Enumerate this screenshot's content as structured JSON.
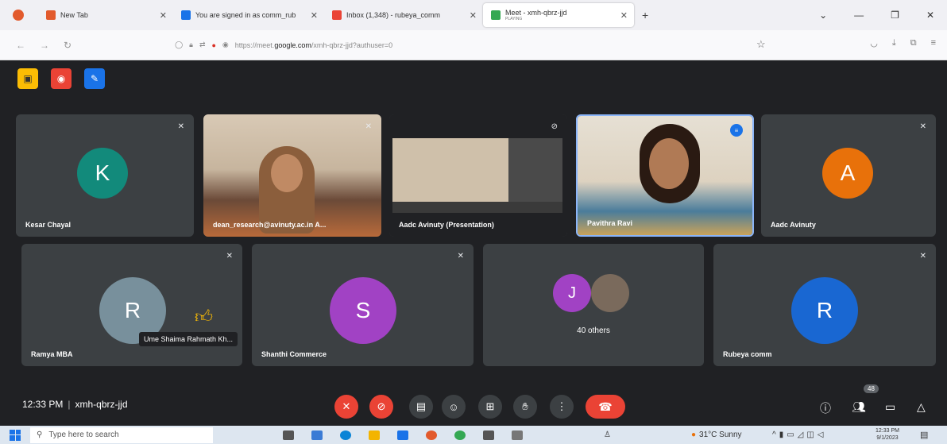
{
  "browser": {
    "tabs": [
      {
        "title": "New Tab",
        "favicon_color": "#e25a2c"
      },
      {
        "title": "You are signed in as comm_rub",
        "favicon_color": "#1a73e8"
      },
      {
        "title": "Inbox (1,348) - rubeya_comm",
        "favicon_color": "#ea4335"
      },
      {
        "title": "Meet - xmh-qbrz-jjd",
        "subtitle": "PLAYING",
        "favicon_color": "#34a853"
      }
    ],
    "url_prefix": "https://meet.",
    "url_domain": "google.com",
    "url_suffix": "/xmh-qbrz-jjd?authuser=0"
  },
  "tiles": [
    {
      "name": "Kesar Chayal",
      "initial": "K",
      "color": "#128a7b"
    },
    {
      "name": "dean_research@avinuty.ac.in A..."
    },
    {
      "name": "Aadc Avinuty (Presentation)"
    },
    {
      "name": "Pavithra Ravi"
    },
    {
      "name": "Aadc Avinuty",
      "initial": "A",
      "color": "#e8710a"
    },
    {
      "name": "Ramya MBA",
      "initial": "R",
      "color": "#78909c"
    },
    {
      "name": "Shanthi Commerce",
      "initial": "S",
      "color": "#a142c4"
    },
    {
      "name": "40 others",
      "initial": "J",
      "color": "#a142c4"
    },
    {
      "name": "Rubeya comm",
      "initial": "R",
      "color": "#1967d2"
    }
  ],
  "tooltip": "Ume Shaima Rahmath Kh...",
  "meeting": {
    "time": "12:33 PM",
    "code": "xmh-qbrz-jjd",
    "participants_badge": "48"
  },
  "taskbar": {
    "search_placeholder": "Type here to search",
    "weather": "31°C  Sunny",
    "clock_time": "12:33 PM",
    "clock_date": "9/1/2023"
  }
}
